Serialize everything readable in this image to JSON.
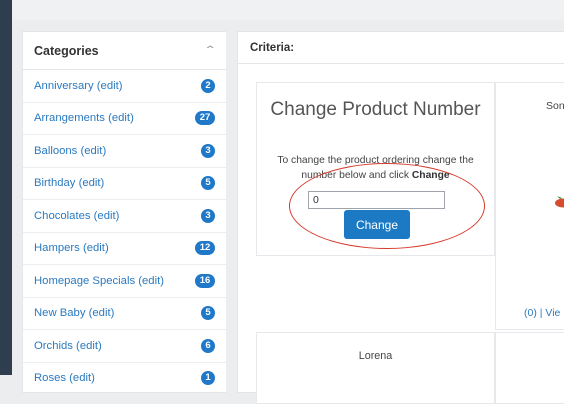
{
  "categories": {
    "title": "Categories",
    "collapse_icon": "chevron-up-icon",
    "items": [
      {
        "label": "Anniversary (edit)",
        "count": "2"
      },
      {
        "label": "Arrangements (edit)",
        "count": "27"
      },
      {
        "label": "Balloons (edit)",
        "count": "3"
      },
      {
        "label": "Birthday (edit)",
        "count": "5"
      },
      {
        "label": "Chocolates (edit)",
        "count": "3"
      },
      {
        "label": "Hampers (edit)",
        "count": "12"
      },
      {
        "label": "Homepage Specials (edit)",
        "count": "16"
      },
      {
        "label": "New Baby (edit)",
        "count": "5"
      },
      {
        "label": "Orchids (edit)",
        "count": "6"
      },
      {
        "label": "Roses (edit)",
        "count": "1"
      }
    ]
  },
  "criteria": {
    "title": "Criteria:",
    "change_box": {
      "title": "Change Product Number",
      "desc_prefix": "To change the product ordering change the number below and click ",
      "desc_bold": "Change",
      "input_value": "0",
      "button_label": "Change"
    },
    "right_cell": {
      "top_text": "Son",
      "link_text": "(0) | Vie"
    },
    "bottom_left": {
      "name": "Lorena"
    }
  },
  "colors": {
    "accent": "#1c7ac4",
    "link": "#2a7ac0",
    "annotation_oval": "#d63a2b",
    "sidebar_dark": "#2e3e4e"
  }
}
